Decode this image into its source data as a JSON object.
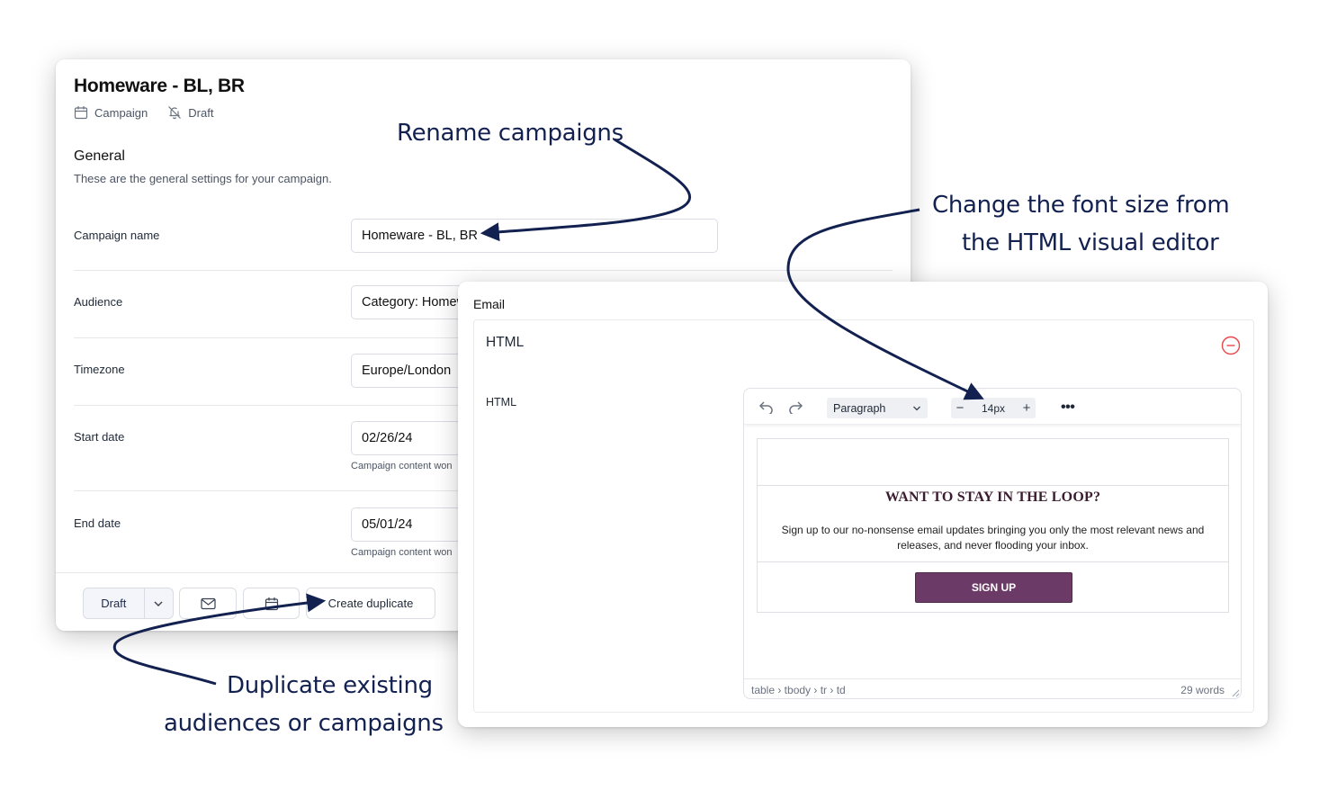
{
  "campaign_panel": {
    "title": "Homeware - BL, BR",
    "type_label": "Campaign",
    "status_label": "Draft",
    "section_title": "General",
    "section_subtitle": "These are the general settings for your campaign.",
    "fields": {
      "campaign_name": {
        "label": "Campaign name",
        "value": "Homeware - BL, BR"
      },
      "audience": {
        "label": "Audience",
        "value": "Category: Homeware"
      },
      "timezone": {
        "label": "Timezone",
        "value": "Europe/London"
      },
      "start_date": {
        "label": "Start date",
        "value": "02/26/24",
        "hint": "Campaign content won"
      },
      "end_date": {
        "label": "End date",
        "value": "05/01/24",
        "hint": "Campaign content won"
      }
    },
    "footer": {
      "status_button": "Draft",
      "duplicate_button": "Create duplicate"
    }
  },
  "email_panel": {
    "section_label": "Email",
    "block_title": "HTML",
    "field_label": "HTML",
    "toolbar": {
      "block_format": "Paragraph",
      "font_size": "14px"
    },
    "content": {
      "heading": "WANT TO STAY IN THE LOOP?",
      "body": "Sign up to our no-nonsense email updates bringing you only the most relevant news and releases, and never flooding your inbox.",
      "button": "SIGN UP"
    },
    "statusbar": {
      "path": "table › tbody › tr › td",
      "word_count": "29 words"
    }
  },
  "callouts": {
    "rename": "Rename campaigns",
    "font_size_line1": "Change the font size from",
    "font_size_line2": "the HTML visual editor",
    "duplicate_line1": "Duplicate existing",
    "duplicate_line2": "audiences or campaigns"
  },
  "colors": {
    "callout_navy": "#132150",
    "signup_purple": "#6b3a66",
    "heading_plum": "#3b1d30",
    "remove_red": "#e5484d"
  }
}
